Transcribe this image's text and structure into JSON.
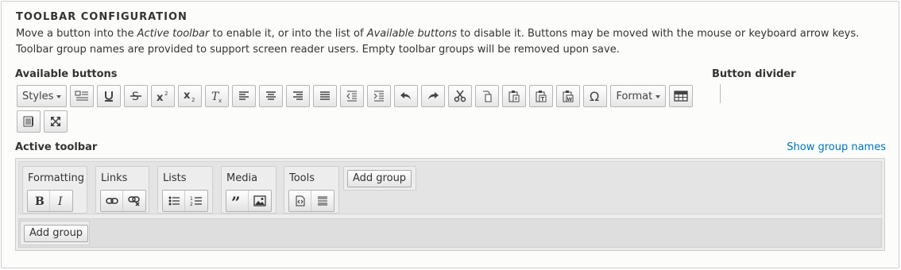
{
  "title": "TOOLBAR CONFIGURATION",
  "description": {
    "p1": "Move a button into the ",
    "em1": "Active toolbar",
    "p2": " to enable it, or into the list of ",
    "em2": "Available buttons",
    "p3": " to disable it. Buttons may be moved with the mouse or keyboard arrow keys. Toolbar group names are provided to support screen reader users. Empty toolbar groups will be removed upon save."
  },
  "available": {
    "label": "Available buttons",
    "styles_label": "Styles",
    "format_label": "Format"
  },
  "divider": {
    "label": "Button divider"
  },
  "active": {
    "label": "Active toolbar",
    "show_group_names": "Show group names",
    "groups": [
      {
        "name": "Formatting"
      },
      {
        "name": "Links"
      },
      {
        "name": "Lists"
      },
      {
        "name": "Media"
      },
      {
        "name": "Tools"
      }
    ],
    "add_group": "Add group",
    "add_group_row2": "Add group"
  },
  "colors": {
    "link": "#0074bd",
    "panel_bg": "#fcfcfa"
  }
}
